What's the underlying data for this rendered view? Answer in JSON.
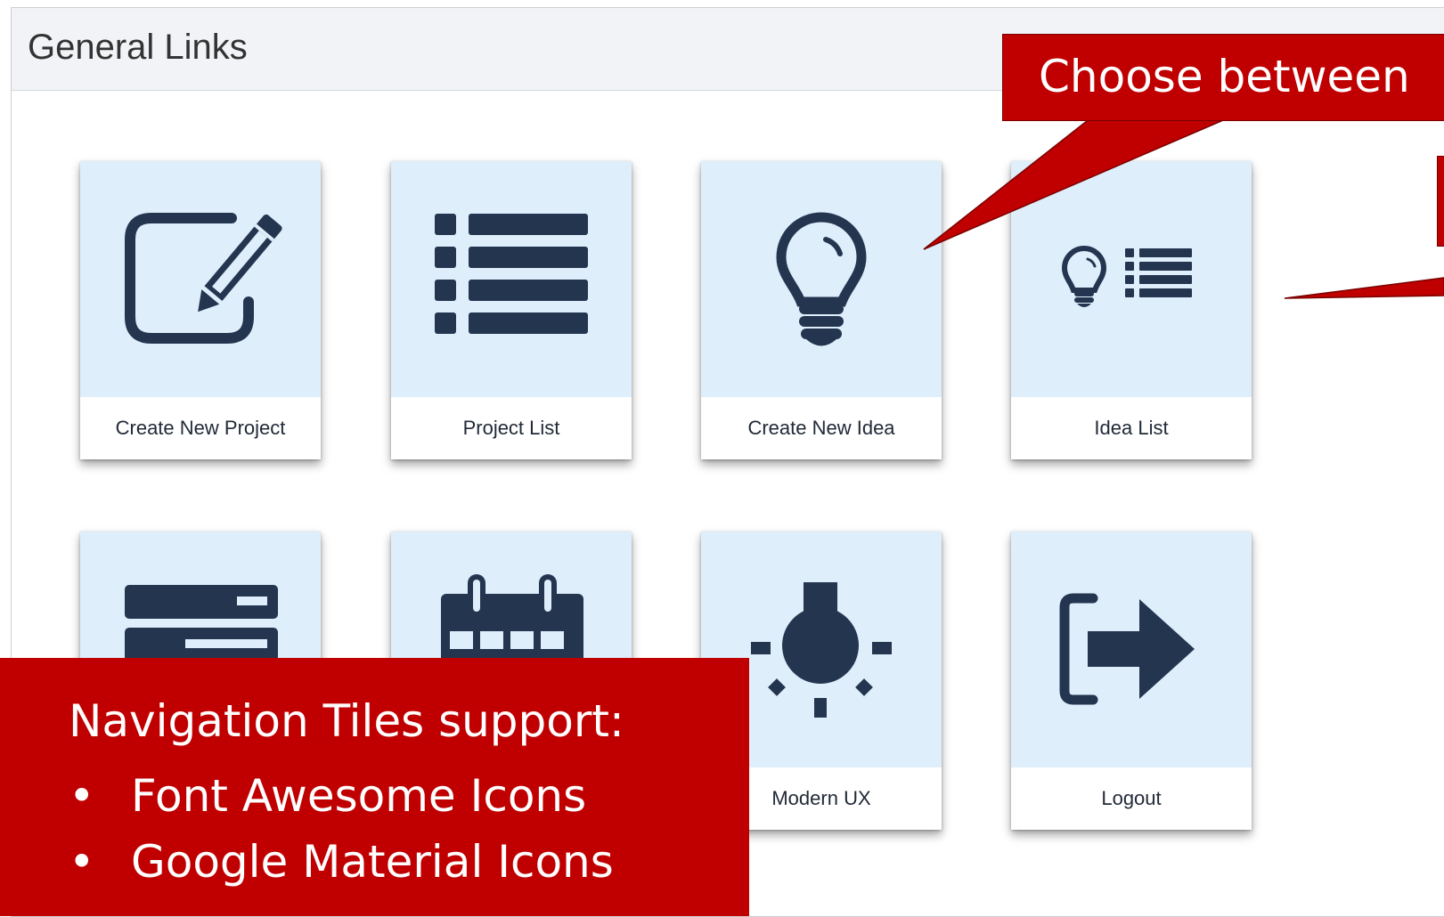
{
  "panel": {
    "title": "General Links"
  },
  "tiles": [
    {
      "label": "Create New Project",
      "icon": "edit-icon"
    },
    {
      "label": "Project List",
      "icon": "list-icon"
    },
    {
      "label": "Create New Idea",
      "icon": "lightbulb-icon"
    },
    {
      "label": "Idea List",
      "icon": "lightbulb-list-icon"
    },
    {
      "label": "",
      "icon": "server-icon"
    },
    {
      "label": "",
      "icon": "calendar-icon"
    },
    {
      "label": "Modern UX",
      "icon": "light-on-icon"
    },
    {
      "label": "Logout",
      "icon": "sign-out-icon"
    }
  ],
  "callouts": {
    "top": "Choose between",
    "bottom": {
      "heading": "Navigation Tiles support:",
      "items": [
        "Font Awesome Icons",
        "Google Material Icons"
      ],
      "bullet": "•"
    }
  },
  "colors": {
    "icon": "#243550",
    "tile_top": "#deeefb",
    "callout": "#c00000"
  }
}
